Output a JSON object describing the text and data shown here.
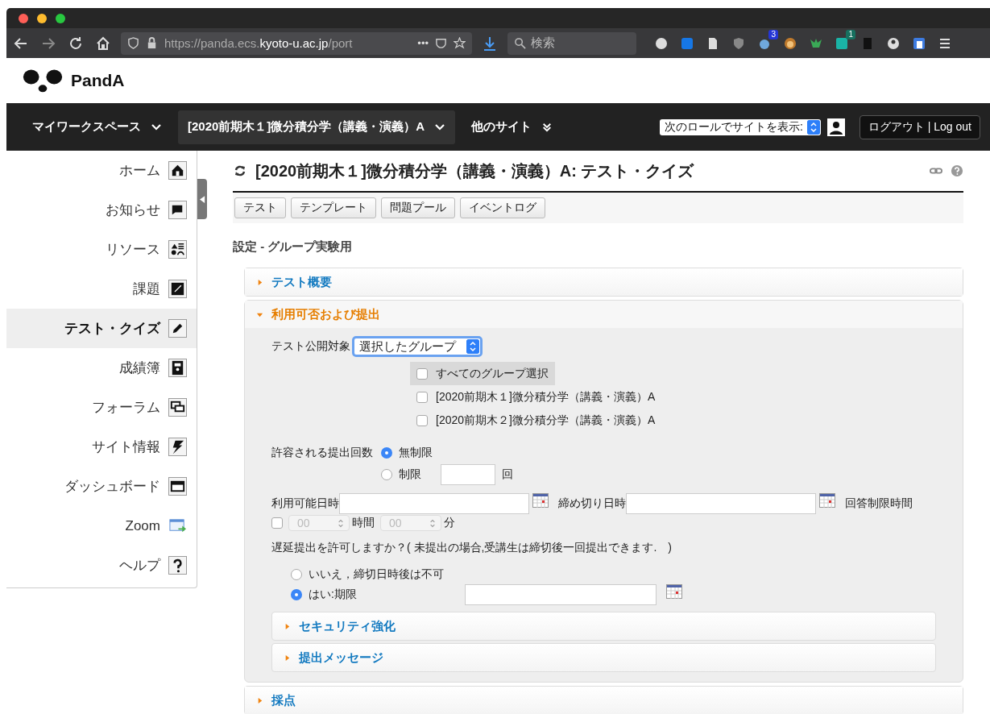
{
  "browser": {
    "url_prefix": "https://panda.ecs.",
    "url_host": "kyoto-u.ac.jp",
    "url_suffix": "/port",
    "more": "•••",
    "search_placeholder": "検索",
    "badges": [
      "3",
      "1"
    ]
  },
  "site": {
    "name": "PandA"
  },
  "nav": {
    "items": [
      {
        "label": "マイワークスペース",
        "selected": false,
        "kind": "menu"
      },
      {
        "label": "[2020前期木１]微分積分学（講義・演義）A",
        "selected": true,
        "kind": "menu"
      },
      {
        "label": "他のサイト",
        "selected": false,
        "kind": "more"
      }
    ],
    "role_label": "次のロールでサイトを表示:",
    "logout": "ログアウト | Log out"
  },
  "sidebar": {
    "items": [
      {
        "label": "ホーム",
        "selected": false
      },
      {
        "label": "お知らせ",
        "selected": false
      },
      {
        "label": "リソース",
        "selected": false
      },
      {
        "label": "課題",
        "selected": false
      },
      {
        "label": "テスト・クイズ",
        "selected": true
      },
      {
        "label": "成績簿",
        "selected": false
      },
      {
        "label": "フォーラム",
        "selected": false
      },
      {
        "label": "サイト情報",
        "selected": false
      },
      {
        "label": "ダッシュボード",
        "selected": false
      },
      {
        "label": "Zoom",
        "selected": false
      },
      {
        "label": "ヘルプ",
        "selected": false
      }
    ]
  },
  "page": {
    "title": "[2020前期木１]微分積分学（講義・演義）A: テスト・クイズ",
    "tool_buttons": [
      "テスト",
      "テンプレート",
      "問題プール",
      "イベントログ"
    ],
    "subtitle": "設定 - グループ実験用",
    "sections": [
      {
        "title": "テスト概要",
        "expanded": false
      },
      {
        "title": "利用可否および提出",
        "expanded": true
      },
      {
        "title": "採点",
        "expanded": false
      }
    ]
  },
  "availability": {
    "release_label": "テスト公開対象",
    "release_value": "選択したグループ",
    "groups": [
      {
        "label": "すべてのグループ選択",
        "checked": false,
        "kind": "all"
      },
      {
        "label": "[2020前期木１]微分積分学（講義・演義）A",
        "checked": false,
        "kind": "group"
      },
      {
        "label": "[2020前期木２]微分積分学（講義・演義）A",
        "checked": false,
        "kind": "group"
      }
    ],
    "submissions_label": "許容される提出回数",
    "submission_options": [
      {
        "label": "無制限",
        "selected": true
      },
      {
        "label": "制限",
        "selected": false
      }
    ],
    "submissions_unit": "回",
    "available_label": "利用可能日時",
    "due_label": "締め切り日時",
    "time_limit_label": "回答制限時間",
    "time_limit": {
      "checked": false,
      "hours": "00",
      "hours_unit": "時間",
      "minutes": "00",
      "minutes_unit": "分"
    },
    "late_question": "遅延提出を許可しますか？( 未提出の場合,受講生は締切後一回提出できます.　)",
    "late_options": [
      {
        "label": "いいえ，締切日時後は不可",
        "selected": false
      },
      {
        "label": "はい:期限",
        "selected": true
      }
    ],
    "subsections": [
      {
        "title": "セキュリティ強化",
        "expanded": false
      },
      {
        "title": "提出メッセージ",
        "expanded": false
      }
    ]
  }
}
